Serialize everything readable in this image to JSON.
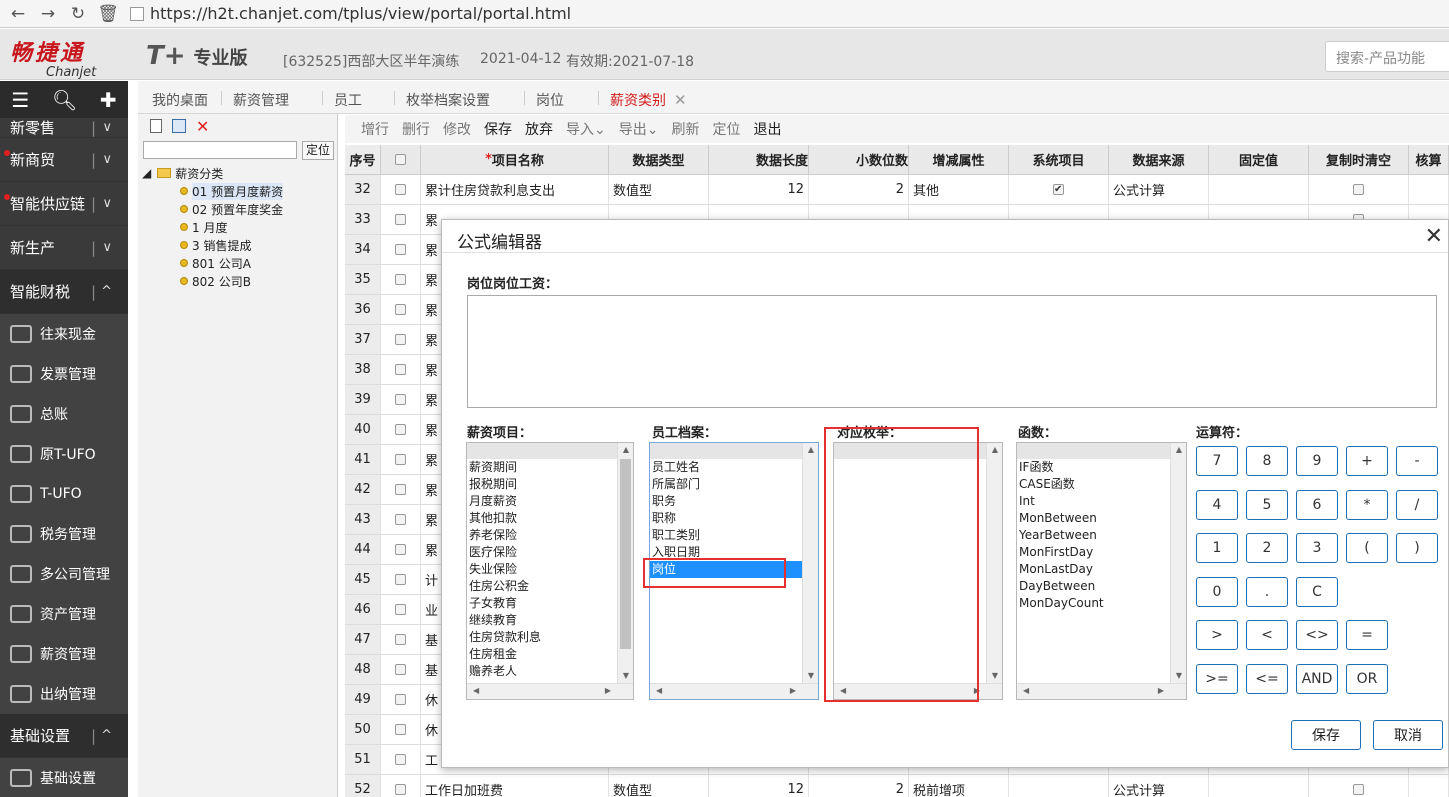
{
  "browser": {
    "url": "https://h2t.chanjet.com/tplus/view/portal/portal.html"
  },
  "header": {
    "logo_cn": "畅捷通",
    "logo_en": "Chanjet",
    "product": "T+",
    "edition": "专业版",
    "account": "[632525]西部大区半年演练",
    "date": "2021-04-12",
    "valid": "有效期:2021-07-18",
    "search_placeholder": "搜索-产品功能"
  },
  "sidebar": {
    "categories": [
      {
        "label": "新零售",
        "dot": false
      },
      {
        "label": "新商贸",
        "dot": true
      },
      {
        "label": "智能供应链",
        "dot": true
      },
      {
        "label": "新生产",
        "dot": false
      },
      {
        "label": "智能财税",
        "dot": false,
        "expanded": true
      }
    ],
    "items": [
      "往来现金",
      "发票管理",
      "总账",
      "原T-UFO",
      "T-UFO",
      "税务管理",
      "多公司管理",
      "资产管理",
      "薪资管理",
      "出纳管理"
    ],
    "bottom_category": "基础设置",
    "bottom_item": "基础设置"
  },
  "tabs": [
    {
      "label": "我的桌面"
    },
    {
      "label": "薪资管理"
    },
    {
      "label": "员工"
    },
    {
      "label": "枚举档案设置"
    },
    {
      "label": "岗位"
    },
    {
      "label": "薪资类别",
      "active": true
    }
  ],
  "tree": {
    "locate": "定位",
    "root": "薪资分类",
    "nodes": [
      "01 预置月度薪资",
      "02 预置年度奖金",
      "1 月度",
      "3 销售提成",
      "801 公司A",
      "802 公司B"
    ]
  },
  "toolbar": {
    "buttons": [
      {
        "label": "增行",
        "enabled": false
      },
      {
        "label": "删行",
        "enabled": false
      },
      {
        "label": "修改",
        "enabled": false
      },
      {
        "label": "保存",
        "enabled": true
      },
      {
        "label": "放弃",
        "enabled": true
      },
      {
        "label": "导入⌄",
        "enabled": false
      },
      {
        "label": "导出⌄",
        "enabled": false
      },
      {
        "label": "刷新",
        "enabled": false
      },
      {
        "label": "定位",
        "enabled": false
      },
      {
        "label": "退出",
        "enabled": true
      }
    ]
  },
  "grid": {
    "headers": [
      "序号",
      "",
      "项目名称",
      "数据类型",
      "数据长度",
      "小数位数",
      "增减属性",
      "系统项目",
      "数据来源",
      "固定值",
      "复制时清空",
      "核算"
    ],
    "rows": [
      {
        "no": "32",
        "name": "累计住房贷款利息支出",
        "type": "数值型",
        "len": "12",
        "dec": "2",
        "attr": "其他",
        "sys": true,
        "src": "公式计算"
      },
      {
        "no": "33",
        "name": "累",
        "type": "",
        "len": "",
        "dec": "",
        "attr": "",
        "sys": false,
        "src": ""
      },
      {
        "no": "34",
        "name": "累",
        "type": "",
        "len": "",
        "dec": "",
        "attr": "",
        "sys": false,
        "src": ""
      },
      {
        "no": "35",
        "name": "累",
        "type": "",
        "len": "",
        "dec": "",
        "attr": "",
        "sys": false,
        "src": ""
      },
      {
        "no": "36",
        "name": "累",
        "type": "",
        "len": "",
        "dec": "",
        "attr": "",
        "sys": false,
        "src": ""
      },
      {
        "no": "37",
        "name": "累",
        "type": "",
        "len": "",
        "dec": "",
        "attr": "",
        "sys": false,
        "src": ""
      },
      {
        "no": "38",
        "name": "累",
        "type": "",
        "len": "",
        "dec": "",
        "attr": "",
        "sys": false,
        "src": ""
      },
      {
        "no": "39",
        "name": "累",
        "type": "",
        "len": "",
        "dec": "",
        "attr": "",
        "sys": false,
        "src": ""
      },
      {
        "no": "40",
        "name": "累",
        "type": "",
        "len": "",
        "dec": "",
        "attr": "",
        "sys": false,
        "src": ""
      },
      {
        "no": "41",
        "name": "累",
        "type": "",
        "len": "",
        "dec": "",
        "attr": "",
        "sys": false,
        "src": ""
      },
      {
        "no": "42",
        "name": "累",
        "type": "",
        "len": "",
        "dec": "",
        "attr": "",
        "sys": false,
        "src": ""
      },
      {
        "no": "43",
        "name": "累",
        "type": "",
        "len": "",
        "dec": "",
        "attr": "",
        "sys": false,
        "src": ""
      },
      {
        "no": "44",
        "name": "累",
        "type": "",
        "len": "",
        "dec": "",
        "attr": "",
        "sys": false,
        "src": ""
      },
      {
        "no": "45",
        "name": "计",
        "type": "",
        "len": "",
        "dec": "",
        "attr": "",
        "sys": false,
        "src": ""
      },
      {
        "no": "46",
        "name": "业",
        "type": "",
        "len": "",
        "dec": "",
        "attr": "",
        "sys": false,
        "src": ""
      },
      {
        "no": "47",
        "name": "基",
        "type": "",
        "len": "",
        "dec": "",
        "attr": "",
        "sys": false,
        "src": ""
      },
      {
        "no": "48",
        "name": "基",
        "type": "",
        "len": "",
        "dec": "",
        "attr": "",
        "sys": false,
        "src": ""
      },
      {
        "no": "49",
        "name": "休",
        "type": "",
        "len": "",
        "dec": "",
        "attr": "",
        "sys": false,
        "src": ""
      },
      {
        "no": "50",
        "name": "休",
        "type": "",
        "len": "",
        "dec": "",
        "attr": "",
        "sys": false,
        "src": ""
      },
      {
        "no": "51",
        "name": "工",
        "type": "",
        "len": "",
        "dec": "",
        "attr": "",
        "sys": false,
        "src": ""
      },
      {
        "no": "52",
        "name": "工作日加班费",
        "type": "数值型",
        "len": "12",
        "dec": "2",
        "attr": "税前增项",
        "sys": false,
        "src": "公式计算"
      }
    ]
  },
  "dialog": {
    "title": "公式编辑器",
    "formula_label": "岗位岗位工资：",
    "formula_value": "",
    "salary_label": "薪资项目：",
    "salary_items": [
      "薪资期间",
      "报税期间",
      "月度薪资",
      "其他扣款",
      "养老保险",
      "医疗保险",
      "失业保险",
      "住房公积金",
      "子女教育",
      "继续教育",
      "住房贷款利息",
      "住房租金",
      "赡养老人"
    ],
    "employee_label": "员工档案：",
    "employee_items": [
      "员工姓名",
      "所属部门",
      "职务",
      "职称",
      "职工类别",
      "入职日期",
      "岗位"
    ],
    "employee_selected": "岗位",
    "enum_label": "对应枚举：",
    "func_label": "函数：",
    "func_items": [
      "IF函数",
      "CASE函数",
      "Int",
      "MonBetween",
      "YearBetween",
      "MonFirstDay",
      "MonLastDay",
      "DayBetween",
      "MonDayCount"
    ],
    "op_label": "运算符：",
    "operators": [
      [
        "7",
        "8",
        "9",
        "+",
        "-"
      ],
      [
        "4",
        "5",
        "6",
        "*",
        "/"
      ],
      [
        "1",
        "2",
        "3",
        "(",
        ")"
      ],
      [
        "0",
        ".",
        "C"
      ],
      [
        ">",
        "<",
        "<>",
        "="
      ],
      [
        ">=",
        "<=",
        "AND",
        "OR"
      ]
    ],
    "save": "保存",
    "cancel": "取消"
  },
  "colors": {
    "accent": "#d01e1e",
    "highlight_box": "#e53030",
    "select": "#1e90ff",
    "sidebar": "#3a3a3a"
  }
}
